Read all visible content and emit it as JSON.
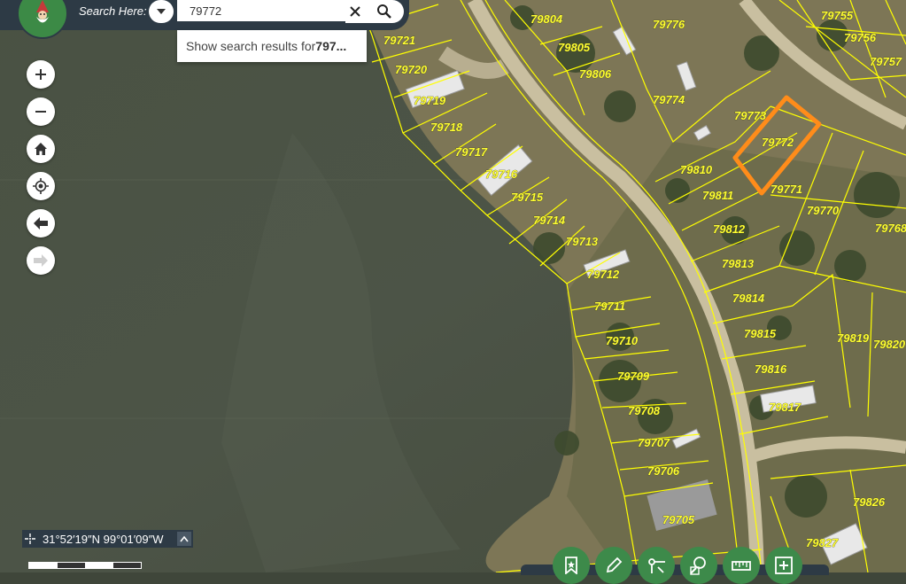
{
  "search": {
    "label": "Search Here:",
    "value": "79772",
    "suggestion_prefix": "Show search results for ",
    "suggestion_bold": "797..."
  },
  "coordinates": {
    "text": "31°52′19″N 99°01′09″W"
  },
  "parcels": [
    {
      "id": "79721"
    },
    {
      "id": "79720"
    },
    {
      "id": "79719"
    },
    {
      "id": "79718"
    },
    {
      "id": "79717"
    },
    {
      "id": "79716"
    },
    {
      "id": "79715"
    },
    {
      "id": "79714"
    },
    {
      "id": "79713"
    },
    {
      "id": "79712"
    },
    {
      "id": "79711"
    },
    {
      "id": "79710"
    },
    {
      "id": "79709"
    },
    {
      "id": "79708"
    },
    {
      "id": "79707"
    },
    {
      "id": "79706"
    },
    {
      "id": "79705"
    },
    {
      "id": "79804"
    },
    {
      "id": "79805"
    },
    {
      "id": "79806"
    },
    {
      "id": "79776"
    },
    {
      "id": "79774"
    },
    {
      "id": "79773"
    },
    {
      "id": "79772"
    },
    {
      "id": "79771"
    },
    {
      "id": "79770"
    },
    {
      "id": "79810"
    },
    {
      "id": "79811"
    },
    {
      "id": "79812"
    },
    {
      "id": "79813"
    },
    {
      "id": "79814"
    },
    {
      "id": "79815"
    },
    {
      "id": "79816"
    },
    {
      "id": "79817"
    },
    {
      "id": "79819"
    },
    {
      "id": "79820"
    },
    {
      "id": "79755"
    },
    {
      "id": "79756"
    },
    {
      "id": "79757"
    },
    {
      "id": "79768"
    },
    {
      "id": "79826"
    },
    {
      "id": "79827"
    }
  ],
  "highlighted_parcel": "79772",
  "icons": {
    "logo": "gnome-logo-icon",
    "dropdown": "caret-down-icon",
    "clear": "close-icon",
    "search": "search-icon",
    "zoom_in": "plus-icon",
    "zoom_out": "minus-icon",
    "home": "home-icon",
    "locate": "locate-icon",
    "back": "arrow-left-icon",
    "forward": "arrow-right-icon",
    "coord_mode": "crosshair-icon",
    "coord_toggle": "chevron-up-icon",
    "bottom_tools": [
      "bookmark-icon",
      "pencil-icon",
      "measure-icon",
      "find-parcel-icon",
      "ruler-icon",
      "add-icon"
    ]
  },
  "colors": {
    "parcel_line": "#ffff00",
    "parcel_label": "#ffff33",
    "highlight": "#ff8c1a",
    "toolbar": "#2d3a45",
    "tool_green": "#3d8a4a"
  }
}
